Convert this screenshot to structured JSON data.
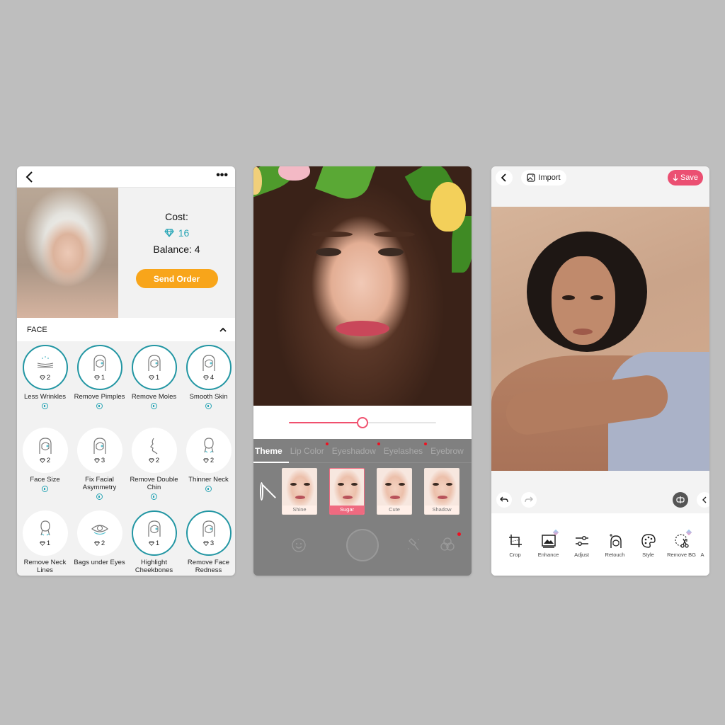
{
  "screen1": {
    "header": {
      "back_icon": "chevron-left-icon",
      "more_icon": "more-horizontal-icon"
    },
    "order": {
      "cost_label": "Cost:",
      "cost_value": "16",
      "cost_icon": "diamond-icon",
      "balance_label": "Balance: 4",
      "send_button": "Send Order"
    },
    "section": {
      "title": "FACE",
      "toggle_icon": "chevron-up-icon"
    },
    "services": [
      {
        "label": "Less Wrinkles",
        "price": "2",
        "selected": true,
        "icon": "wrinkles-icon"
      },
      {
        "label": "Remove Pimples",
        "price": "1",
        "selected": true,
        "icon": "face-icon"
      },
      {
        "label": "Remove Moles",
        "price": "1",
        "selected": true,
        "icon": "face-mole-icon"
      },
      {
        "label": "Smooth Skin",
        "price": "4",
        "selected": true,
        "icon": "face-icon"
      },
      {
        "label": "Face Size",
        "price": "2",
        "selected": false,
        "icon": "face-icon"
      },
      {
        "label": "Fix Facial Asymmetry",
        "price": "3",
        "selected": false,
        "icon": "face-icon"
      },
      {
        "label": "Remove Double Chin",
        "price": "2",
        "selected": false,
        "icon": "profile-icon"
      },
      {
        "label": "Thinner Neck",
        "price": "2",
        "selected": false,
        "icon": "neck-icon"
      },
      {
        "label": "Remove Neck Lines",
        "price": "1",
        "selected": false,
        "icon": "neck-icon"
      },
      {
        "label": "Bags under Eyes",
        "price": "2",
        "selected": false,
        "icon": "eye-icon"
      },
      {
        "label": "Highlight Cheekbones",
        "price": "1",
        "selected": true,
        "icon": "face-icon"
      },
      {
        "label": "Remove Face Redness",
        "price": "3",
        "selected": true,
        "icon": "face-icon"
      }
    ],
    "colors": {
      "accent": "#2aa5b5",
      "button": "#f8a51a"
    }
  },
  "screen2": {
    "slider": {
      "value_percent": 50
    },
    "tabs": [
      {
        "label": "Theme",
        "active": true,
        "dot": false
      },
      {
        "label": "Lip Color",
        "active": false,
        "dot": true
      },
      {
        "label": "Eyeshadow",
        "active": false,
        "dot": true
      },
      {
        "label": "Eyelashes",
        "active": false,
        "dot": true
      },
      {
        "label": "Eyebrow",
        "active": false,
        "dot": false
      }
    ],
    "looks": [
      {
        "label": "Shine",
        "selected": false
      },
      {
        "label": "Sugar",
        "selected": true
      },
      {
        "label": "Cute",
        "selected": false
      },
      {
        "label": "Shadow",
        "selected": false
      }
    ],
    "bottom_icons": [
      "smile-icon",
      "shutter-button",
      "makeup-brush-icon",
      "filters-icon"
    ],
    "colors": {
      "accent": "#f0506e",
      "notification": "#f01020"
    }
  },
  "screen3": {
    "header": {
      "import_label": "Import",
      "save_label": "Save"
    },
    "tools": [
      {
        "label": "Crop",
        "icon": "crop-icon",
        "premium": false
      },
      {
        "label": "Enhance",
        "icon": "image-enhance-icon",
        "premium": true
      },
      {
        "label": "Adjust",
        "icon": "sliders-icon",
        "premium": false
      },
      {
        "label": "Retouch",
        "icon": "retouch-icon",
        "premium": false
      },
      {
        "label": "Style",
        "icon": "palette-icon",
        "premium": false
      },
      {
        "label": "Remove BG",
        "icon": "scissors-icon",
        "premium": true
      },
      {
        "label": "A",
        "icon": "",
        "premium": false
      }
    ],
    "colors": {
      "save": "#eb4f72"
    }
  }
}
